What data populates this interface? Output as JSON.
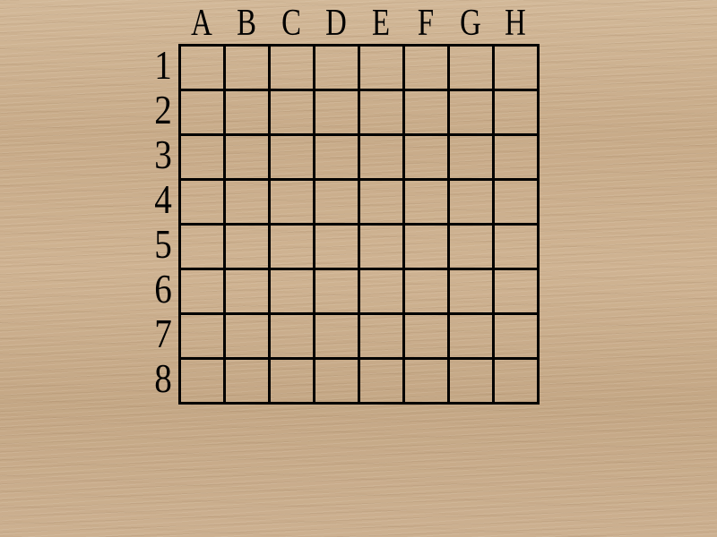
{
  "board": {
    "columns": [
      "A",
      "B",
      "C",
      "D",
      "E",
      "F",
      "G",
      "H"
    ],
    "rows": [
      "1",
      "2",
      "3",
      "4",
      "5",
      "6",
      "7",
      "8"
    ],
    "cells": [
      [
        "",
        "",
        "",
        "",
        "",
        "",
        "",
        ""
      ],
      [
        "",
        "",
        "",
        "",
        "",
        "",
        "",
        ""
      ],
      [
        "",
        "",
        "",
        "",
        "",
        "",
        "",
        ""
      ],
      [
        "",
        "",
        "",
        "",
        "",
        "",
        "",
        ""
      ],
      [
        "",
        "",
        "",
        "",
        "",
        "",
        "",
        ""
      ],
      [
        "",
        "",
        "",
        "",
        "",
        "",
        "",
        ""
      ],
      [
        "",
        "",
        "",
        "",
        "",
        "",
        "",
        ""
      ],
      [
        "",
        "",
        "",
        "",
        "",
        "",
        "",
        ""
      ]
    ]
  },
  "colors": {
    "line": "#000000",
    "wood": "#c9ae8d"
  }
}
